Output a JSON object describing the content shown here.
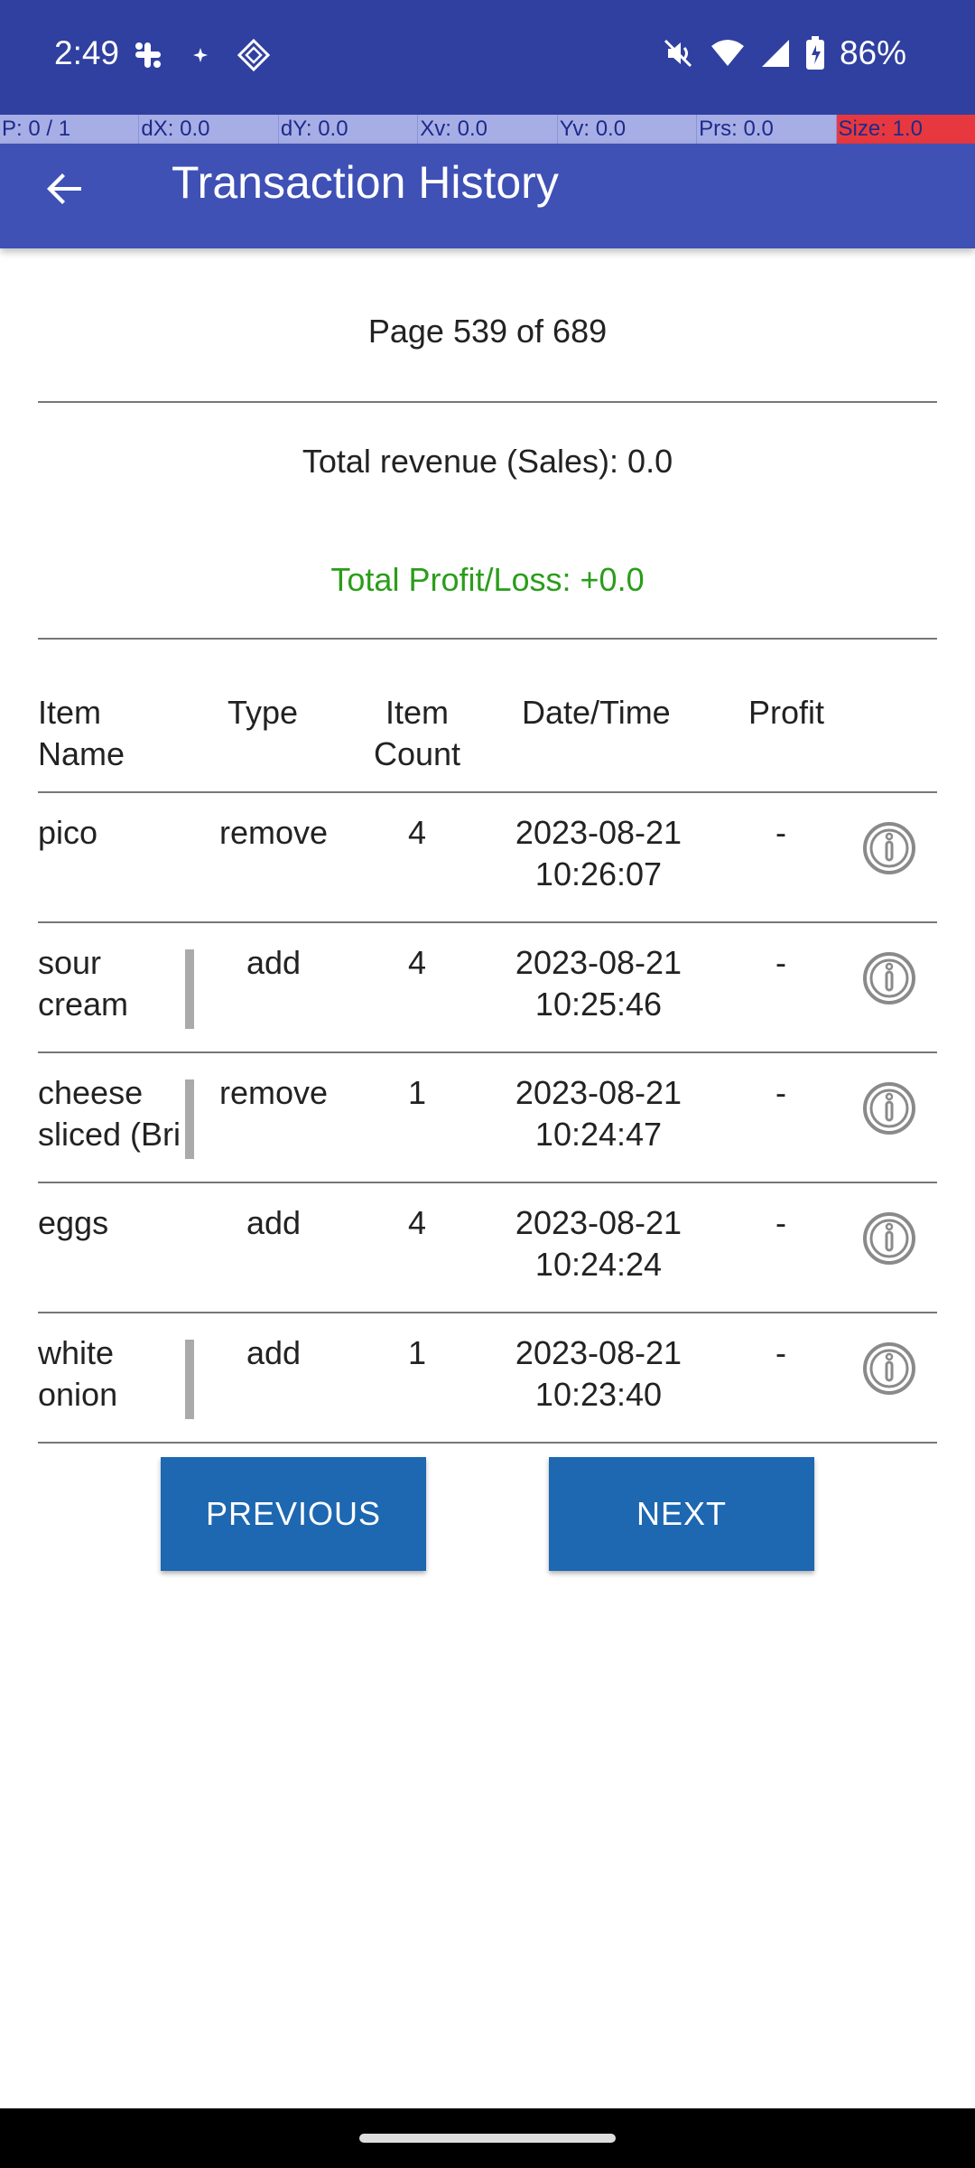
{
  "status_bar": {
    "time": "2:49",
    "battery": "86%",
    "icons_left": [
      "slack-icon",
      "sparkle-icon",
      "diamond-app-icon"
    ],
    "icons_right": [
      "mute-icon",
      "wifi-icon",
      "signal-icon",
      "battery-icon"
    ]
  },
  "pointer_bar": {
    "p": "P: 0 / 1",
    "dx": "dX: 0.0",
    "dy": "dY: 0.0",
    "xv": "Xv: 0.0",
    "yv": "Yv: 0.0",
    "prs": "Prs: 0.0",
    "size": "Size: 1.0"
  },
  "app_bar": {
    "title": "Transaction History"
  },
  "summary": {
    "page": "Page 539 of 689",
    "revenue": "Total revenue (Sales): 0.0",
    "profit_loss": "Total Profit/Loss: +0.0"
  },
  "table": {
    "headers": {
      "item_name_1": "Item",
      "item_name_2": "Name",
      "type": "Type",
      "item_count_1": "Item",
      "item_count_2": "Count",
      "datetime": "Date/Time",
      "profit": "Profit"
    },
    "rows": [
      {
        "name_1": "pico",
        "name_2": "",
        "type": "remove",
        "count": "4",
        "date": "2023-08-21",
        "time": "10:26:07",
        "profit": "-"
      },
      {
        "name_1": "sour",
        "name_2": "cream",
        "type": "add",
        "count": "4",
        "date": "2023-08-21",
        "time": "10:25:46",
        "profit": "-"
      },
      {
        "name_1": "cheese",
        "name_2": "sliced (Bri",
        "type": "remove",
        "count": "1",
        "date": "2023-08-21",
        "time": "10:24:47",
        "profit": "-"
      },
      {
        "name_1": "eggs",
        "name_2": "",
        "type": "add",
        "count": "4",
        "date": "2023-08-21",
        "time": "10:24:24",
        "profit": "-"
      },
      {
        "name_1": "white",
        "name_2": "onion",
        "type": "add",
        "count": "1",
        "date": "2023-08-21",
        "time": "10:23:40",
        "profit": "-"
      }
    ]
  },
  "buttons": {
    "previous": "PREVIOUS",
    "next": "NEXT"
  },
  "colors": {
    "status_bar": "#3040a0",
    "app_bar": "#3f51b5",
    "button": "#1e67b1",
    "profit_text": "#2a9d1a"
  }
}
